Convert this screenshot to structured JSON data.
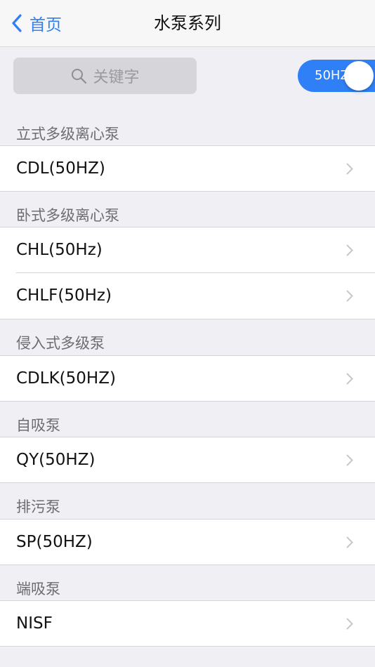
{
  "nav": {
    "back_label": "首页",
    "title": "水泵系列"
  },
  "search": {
    "placeholder": "关键字"
  },
  "toggle": {
    "label": "50HZ",
    "on": true,
    "color": "#2f7ff6"
  },
  "sections": [
    {
      "header": "立式多级离心泵",
      "items": [
        "CDL(50HZ)"
      ]
    },
    {
      "header": "卧式多级离心泵",
      "items": [
        "CHL(50Hz)",
        "CHLF(50Hz)"
      ]
    },
    {
      "header": "侵入式多级泵",
      "items": [
        "CDLK(50HZ)"
      ]
    },
    {
      "header": "自吸泵",
      "items": [
        "QY(50HZ)"
      ]
    },
    {
      "header": "排污泵",
      "items": [
        "SP(50HZ)"
      ]
    },
    {
      "header": "端吸泵",
      "items": [
        "NISF"
      ]
    }
  ]
}
